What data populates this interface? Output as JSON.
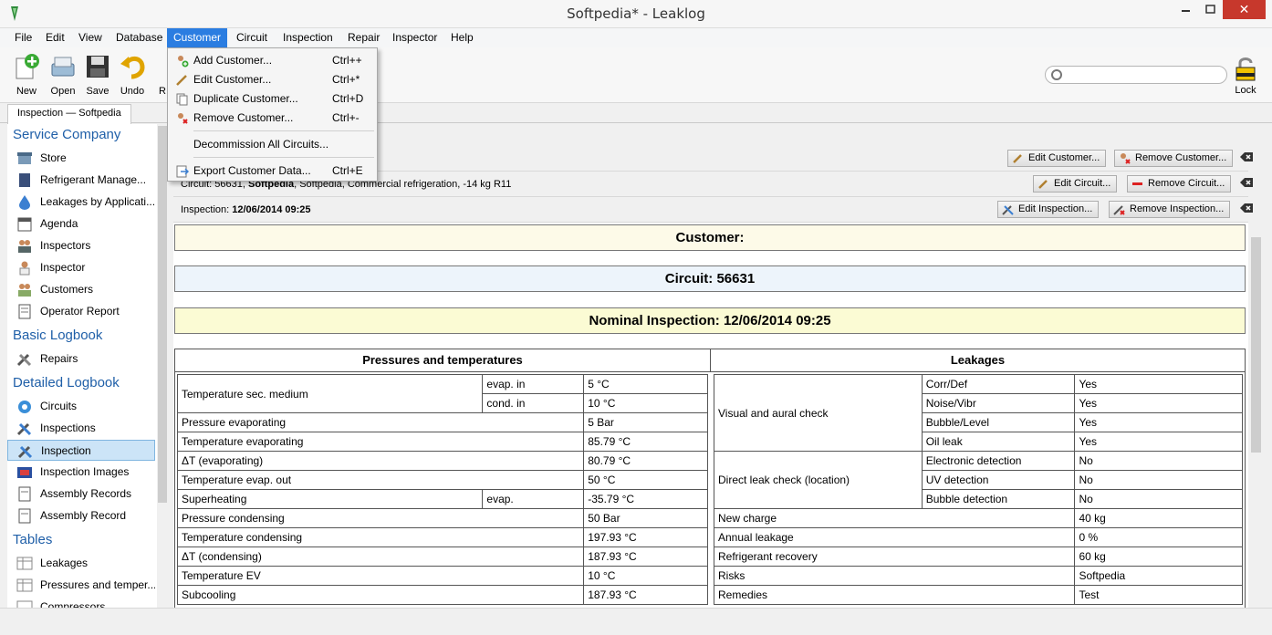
{
  "window": {
    "title": "Softpedia* - Leaklog",
    "close_glyph": "✕",
    "minimize_glyph": "—",
    "maximize_glyph": "☐"
  },
  "menubar": {
    "items": [
      "File",
      "Edit",
      "View",
      "Database",
      "Customer",
      "Circuit",
      "Inspection",
      "Repair",
      "Inspector",
      "Help"
    ],
    "active": "Customer"
  },
  "toolbar": {
    "new_label": "New",
    "open_label": "Open",
    "save_label": "Save",
    "undo_label": "Undo",
    "redo_label": "R",
    "lock_label": "Lock",
    "search_value": ""
  },
  "tabs": {
    "doc_tab": "Inspection — Softpedia"
  },
  "customer_menu": {
    "items": [
      {
        "label": "Add Customer...",
        "shortcut": "Ctrl++",
        "icon": "add-customer-icon"
      },
      {
        "label": "Edit Customer...",
        "shortcut": "Ctrl+*",
        "icon": "edit-customer-icon"
      },
      {
        "label": "Duplicate Customer...",
        "shortcut": "Ctrl+D",
        "icon": "duplicate-customer-icon"
      },
      {
        "label": "Remove Customer...",
        "shortcut": "Ctrl+-",
        "icon": "remove-customer-icon"
      },
      {
        "label": "Decommission All Circuits...",
        "shortcut": "",
        "icon": ""
      },
      {
        "label": "Export Customer Data...",
        "shortcut": "Ctrl+E",
        "icon": "export-icon"
      }
    ]
  },
  "sidebar": {
    "sections": [
      {
        "title": "Service Company",
        "items": [
          "Store",
          "Refrigerant Manage...",
          "Leakages by Applicati...",
          "Agenda",
          "Inspectors",
          "Inspector",
          "Customers",
          "Operator Report"
        ]
      },
      {
        "title": "Basic Logbook",
        "items": [
          "Repairs"
        ]
      },
      {
        "title": "Detailed Logbook",
        "items": [
          "Circuits",
          "Inspections",
          "Inspection",
          "Inspection Images",
          "Assembly Records",
          "Assembly Record"
        ]
      },
      {
        "title": "Tables",
        "items": [
          "Leakages",
          "Pressures and temper...",
          "Compressors"
        ]
      }
    ],
    "selected": "Inspection"
  },
  "infobars": {
    "circuit_prefix": "Circuit: 56631, ",
    "circuit_bold": "Softpedia",
    "circuit_suffix": ", Softpedia, Commercial refrigeration, -14 kg R11",
    "inspection_prefix": "Inspection: ",
    "inspection_bold": "12/06/2014 09:25",
    "edit_customer": "Edit Customer...",
    "remove_customer": "Remove Customer...",
    "edit_circuit": "Edit Circuit...",
    "remove_circuit": "Remove Circuit...",
    "edit_inspection": "Edit Inspection...",
    "remove_inspection": "Remove Inspection..."
  },
  "report": {
    "customer_banner": "Customer:",
    "circuit_banner": "Circuit: 56631",
    "inspection_banner": "Nominal Inspection: 12/06/2014 09:25",
    "left_header": "Pressures and temperatures",
    "right_header": "Leakages",
    "left_rows": [
      {
        "label": "Temperature sec. medium",
        "sub": "evap. in",
        "value": "5 °C"
      },
      {
        "label": "",
        "sub": "cond. in",
        "value": "10 °C"
      },
      {
        "label": "Pressure evaporating",
        "sub": "",
        "value": "5 Bar"
      },
      {
        "label": "Temperature evaporating",
        "sub": "",
        "value": "85.79 °C"
      },
      {
        "label": "ΔT (evaporating)",
        "sub": "",
        "value": "80.79 °C"
      },
      {
        "label": "Temperature evap. out",
        "sub": "",
        "value": "50 °C"
      },
      {
        "label": "Superheating",
        "sub": "evap.",
        "value": "-35.79 °C"
      },
      {
        "label": "Pressure condensing",
        "sub": "",
        "value": "50 Bar"
      },
      {
        "label": "Temperature condensing",
        "sub": "",
        "value": "197.93 °C"
      },
      {
        "label": "ΔT (condensing)",
        "sub": "",
        "value": "187.93 °C"
      },
      {
        "label": "Temperature EV",
        "sub": "",
        "value": "10 °C"
      },
      {
        "label": "Subcooling",
        "sub": "",
        "value": "187.93 °C"
      }
    ],
    "right_groups": {
      "visual": {
        "label": "Visual and aural check",
        "rows": [
          [
            "Corr/Def",
            "Yes"
          ],
          [
            "Noise/Vibr",
            "Yes"
          ],
          [
            "Bubble/Level",
            "Yes"
          ],
          [
            "Oil leak",
            "Yes"
          ]
        ]
      },
      "direct": {
        "label": "Direct leak check (location)",
        "rows": [
          [
            "Electronic detection",
            "No"
          ],
          [
            "UV detection",
            "No"
          ],
          [
            "Bubble detection",
            "No"
          ]
        ]
      },
      "simple": [
        [
          "New charge",
          "40 kg"
        ],
        [
          "Annual leakage",
          "0 %"
        ],
        [
          "Refrigerant recovery",
          "60 kg"
        ],
        [
          "Risks",
          "Softpedia"
        ],
        [
          "Remedies",
          "Test"
        ]
      ]
    }
  }
}
